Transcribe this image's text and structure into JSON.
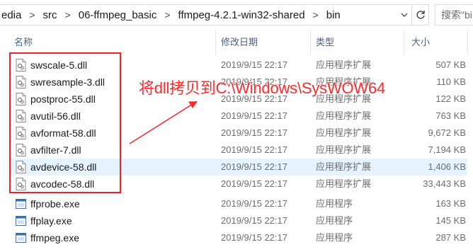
{
  "address_bar": {
    "crumbs": [
      "edia",
      "src",
      "06-ffmpeg_basic",
      "ffmpeg-4.2.1-win32-shared",
      "bin"
    ],
    "separator": ">"
  },
  "search": {
    "placeholder": "搜索\"bi"
  },
  "columns": {
    "name": "名称",
    "date": "修改日期",
    "type": "类型",
    "size": "大小"
  },
  "files": [
    {
      "name": "swscale-5.dll",
      "date": "2019/9/15 22:17",
      "type": "应用程序扩展",
      "size": "507 KB",
      "kind": "dll-icon"
    },
    {
      "name": "swresample-3.dll",
      "date": "2019/9/15 22:17",
      "type": "应用程序扩展",
      "size": "110 KB",
      "kind": "dll-icon"
    },
    {
      "name": "postproc-55.dll",
      "date": "2019/9/15 22:17",
      "type": "应用程序扩展",
      "size": "122 KB",
      "kind": "dll-icon"
    },
    {
      "name": "avutil-56.dll",
      "date": "2019/9/15 22:17",
      "type": "应用程序扩展",
      "size": "763 KB",
      "kind": "dll-icon"
    },
    {
      "name": "avformat-58.dll",
      "date": "2019/9/15 22:17",
      "type": "应用程序扩展",
      "size": "9,672 KB",
      "kind": "dll-icon"
    },
    {
      "name": "avfilter-7.dll",
      "date": "2019/9/15 22:17",
      "type": "应用程序扩展",
      "size": "7,194 KB",
      "kind": "dll-icon"
    },
    {
      "name": "avdevice-58.dll",
      "date": "2019/9/15 22:17",
      "type": "应用程序扩展",
      "size": "1,406 KB",
      "kind": "dll-icon"
    },
    {
      "name": "avcodec-58.dll",
      "date": "2019/9/15 22:17",
      "type": "应用程序扩展",
      "size": "33,443 KB",
      "kind": "dll-icon"
    },
    {
      "name": "ffprobe.exe",
      "date": "2019/9/15 22:17",
      "type": "应用程序",
      "size": "163 KB",
      "kind": "exe-icon"
    },
    {
      "name": "ffplay.exe",
      "date": "2019/9/15 22:17",
      "type": "应用程序",
      "size": "145 KB",
      "kind": "exe-icon"
    },
    {
      "name": "ffmpeg.exe",
      "date": "2019/9/15 22:17",
      "type": "应用程序",
      "size": "287 KB",
      "kind": "exe-icon"
    }
  ],
  "selected_file": "avdevice-58.dll",
  "annotation": {
    "text": "将dll拷贝到C:\\Windows\\SysWOW64"
  },
  "colors": {
    "annotation_red": "#ff2a2a",
    "selection_bg": "#e5f3ff",
    "header_text": "#4c607a",
    "secondary_text": "#6d6d6d"
  }
}
